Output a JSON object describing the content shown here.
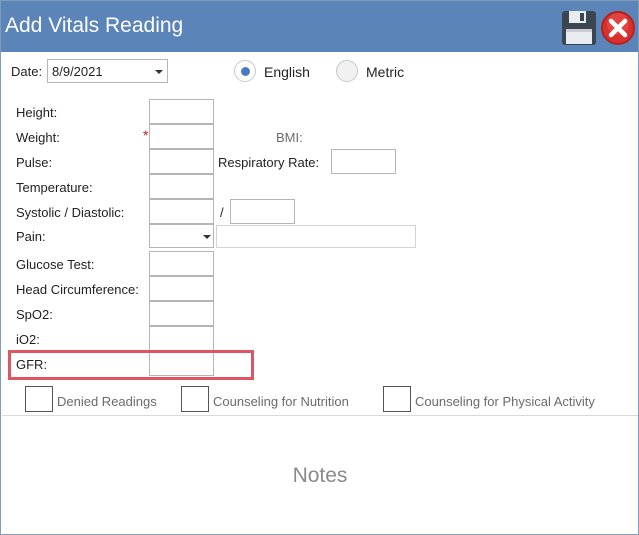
{
  "window": {
    "title": "Add Vitals Reading"
  },
  "header": {
    "date_label": "Date:",
    "date_value": "8/9/2021"
  },
  "units": {
    "english_label": "English",
    "metric_label": "Metric",
    "selected": "English"
  },
  "fields": {
    "height": "Height:",
    "weight": "Weight:",
    "weight_required": "*",
    "bmi": "BMI:",
    "pulse": "Pulse:",
    "respiratory_rate": "Respiratory Rate:",
    "temperature": "Temperature:",
    "systolic_diastolic": "Systolic / Diastolic:",
    "bp_separator": "/",
    "pain": "Pain:",
    "glucose_test": "Glucose Test:",
    "head_circumference": "Head Circumference:",
    "spo2": "SpO2:",
    "io2": "iO2:",
    "gfr": "GFR:"
  },
  "checkboxes": {
    "denied_readings": "Denied Readings",
    "counseling_nutrition": "Counseling for Nutrition",
    "counseling_physical_activity": "Counseling for Physical Activity"
  },
  "notes": {
    "placeholder": "Notes"
  },
  "icons": {
    "save": "floppy-disk-icon",
    "close": "close-icon"
  },
  "colors": {
    "titlebar": "#5b84b9",
    "highlight": "#e05562",
    "radio_selected": "#4a7ac0",
    "required": "#d01818"
  }
}
